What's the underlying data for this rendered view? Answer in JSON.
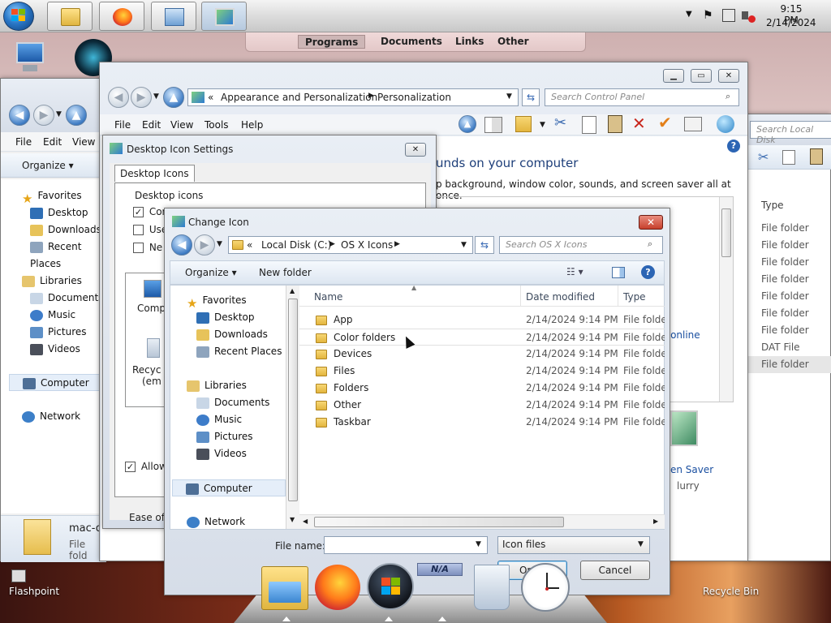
{
  "taskbar": {
    "time": "9:15 PM",
    "date": "2/14/2024",
    "buttons": [
      "file-explorer-icon",
      "firefox-icon",
      "control-panel-icon",
      "personalization-icon"
    ]
  },
  "quickbar": {
    "items": [
      "Programs",
      "Documents",
      "Links",
      "Other"
    ]
  },
  "desktop": {
    "flashpoint_label": "Flashpoint",
    "recycle_label": "Recycle Bin",
    "dock_na_label": "N/A"
  },
  "explorer_back": {
    "menu": [
      "File",
      "Edit",
      "View"
    ],
    "organize": "Organize",
    "search_placeholder": "Search Local Disk",
    "nav": {
      "favorites": "Favorites",
      "fav_items": [
        "Desktop",
        "Downloads",
        "Recent Places"
      ],
      "libraries": "Libraries",
      "lib_items": [
        "Documents",
        "Music",
        "Pictures",
        "Videos"
      ],
      "computer": "Computer",
      "network": "Network"
    },
    "type_header": "Type",
    "types": [
      "File folder",
      "File folder",
      "File folder",
      "File folder",
      "File folder",
      "File folder",
      "File folder",
      "DAT File",
      "File folder"
    ],
    "bottom_item_name": "mac-o",
    "bottom_item_type": "File fold"
  },
  "control_panel": {
    "breadcrumb": [
      "Appearance and Personalization",
      "Personalization"
    ],
    "search_placeholder": "Search Control Panel",
    "menu": [
      "File",
      "Edit",
      "View",
      "Tools",
      "Help"
    ],
    "heading_partial": "unds on your computer",
    "sub_partial": "p background, window color, sounds, and screen saver all at once.",
    "link_online": "s online",
    "screen_saver_label": "en Saver",
    "screen_saver_value": "lurry"
  },
  "desktop_icon_settings": {
    "title": "Desktop Icon Settings",
    "tab": "Desktop Icons",
    "group": "Desktop icons",
    "checks": [
      {
        "label": "Com",
        "checked": true
      },
      {
        "label": "Use",
        "checked": false
      },
      {
        "label": "Ne",
        "checked": false
      }
    ],
    "icon_labels": [
      "Comp",
      "Recyc",
      "(em"
    ],
    "allow_label": "Allow",
    "ease_label": "Ease of A"
  },
  "change_icon": {
    "title": "Change Icon",
    "breadcrumb": [
      "Local Disk (C:)",
      "OS X Icons"
    ],
    "search_placeholder": "Search OS X Icons",
    "organize": "Organize",
    "new_folder": "New folder",
    "nav": {
      "favorites": "Favorites",
      "fav_items": [
        "Desktop",
        "Downloads",
        "Recent Places"
      ],
      "libraries": "Libraries",
      "lib_items": [
        "Documents",
        "Music",
        "Pictures",
        "Videos"
      ],
      "computer": "Computer",
      "network": "Network"
    },
    "columns": {
      "name": "Name",
      "date": "Date modified",
      "type": "Type"
    },
    "rows": [
      {
        "name": "App",
        "date": "2/14/2024 9:14 PM",
        "type": "File folder"
      },
      {
        "name": "Color folders",
        "date": "2/14/2024 9:14 PM",
        "type": "File folder"
      },
      {
        "name": "Devices",
        "date": "2/14/2024 9:14 PM",
        "type": "File folder"
      },
      {
        "name": "Files",
        "date": "2/14/2024 9:14 PM",
        "type": "File folder"
      },
      {
        "name": "Folders",
        "date": "2/14/2024 9:14 PM",
        "type": "File folder"
      },
      {
        "name": "Other",
        "date": "2/14/2024 9:14 PM",
        "type": "File folder"
      },
      {
        "name": "Taskbar",
        "date": "2/14/2024 9:14 PM",
        "type": "File folder"
      }
    ],
    "file_name_label": "File name:",
    "file_name_value": "",
    "filter": "Icon files",
    "open_label": "Open",
    "cancel_label": "Cancel"
  },
  "colors": {
    "accent_blue": "#3f7cc4",
    "close_red": "#c7402c",
    "link_blue": "#1a4fa0"
  }
}
